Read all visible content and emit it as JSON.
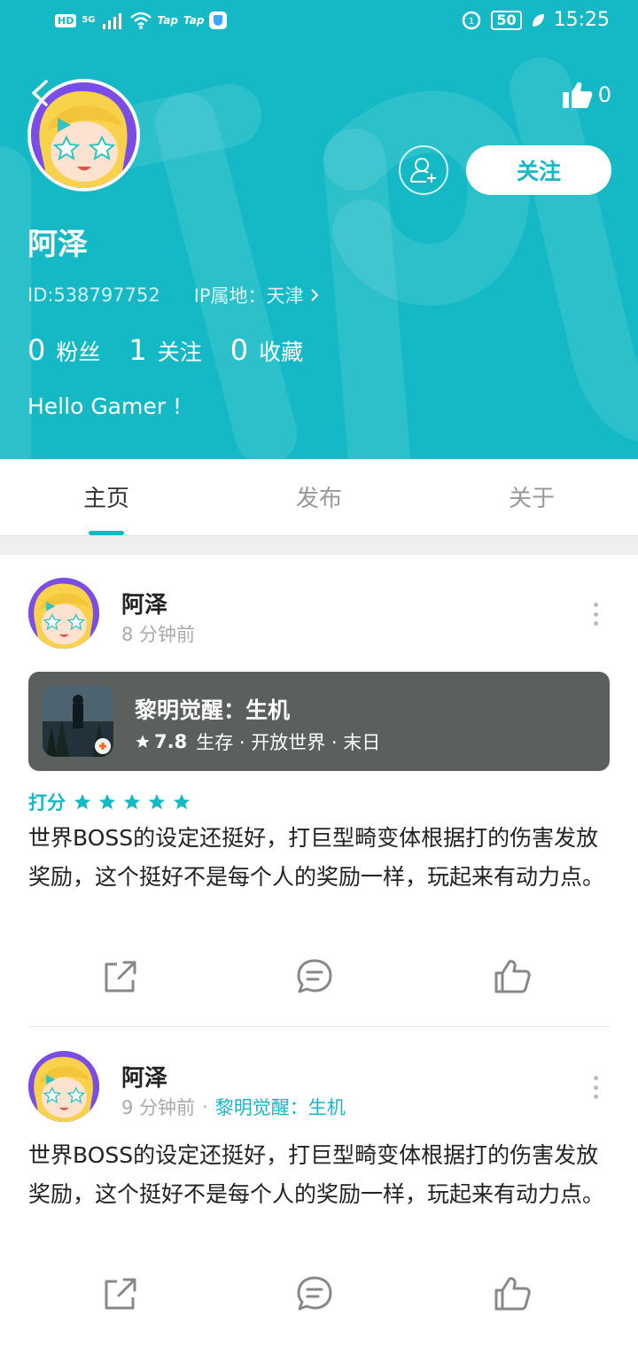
{
  "status_bar": {
    "hd": "HD",
    "net": "5G",
    "tag1": "Tap",
    "tag2": "Tap",
    "battery": "50",
    "time": "15:25"
  },
  "profile": {
    "like_count": "0",
    "follow_label": "关注",
    "name": "阿泽",
    "id_text": "ID:538797752",
    "ip_text": "IP属地：天津",
    "stats": [
      {
        "num": "0",
        "label": "粉丝"
      },
      {
        "num": "1",
        "label": "关注"
      },
      {
        "num": "0",
        "label": "收藏"
      }
    ],
    "bio": "Hello Gamer !"
  },
  "tabs": [
    {
      "label": "主页",
      "active": true
    },
    {
      "label": "发布",
      "active": false
    },
    {
      "label": "关于",
      "active": false
    }
  ],
  "posts": [
    {
      "author": "阿泽",
      "time": "8 分钟前",
      "game": {
        "title": "黎明觉醒：生机",
        "rating": "7.8",
        "tags": "生存 · 开放世界 · 末日"
      },
      "rating_label": "打分",
      "stars": 5,
      "body": "世界BOSS的设定还挺好，打巨型畸变体根据打的伤害发放奖励，这个挺好不是每个人的奖励一样，玩起来有动力点。"
    },
    {
      "author": "阿泽",
      "time": "9 分钟前",
      "game_link": "黎明觉醒：生机",
      "body": "世界BOSS的设定还挺好，打巨型畸变体根据打的伤害发放奖励，这个挺好不是每个人的奖励一样，玩起来有动力点。"
    }
  ],
  "colors": {
    "accent": "#15b9c6",
    "card": "#5b605f",
    "avatar_bg": "#7a4de8"
  }
}
